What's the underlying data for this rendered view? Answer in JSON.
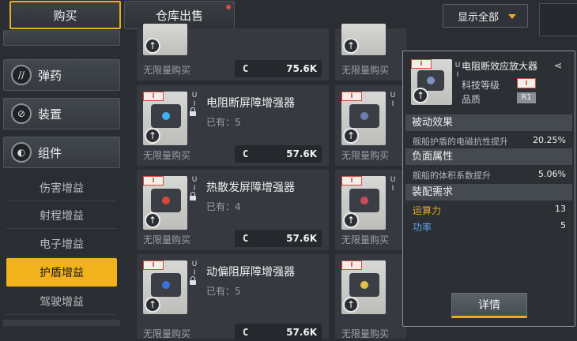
{
  "tabs": {
    "buy": "购买",
    "sell": "仓库出售"
  },
  "filter": {
    "label": "显示全部"
  },
  "sidebar": {
    "categories": [
      {
        "label": "弹药",
        "icon": "ammo-icon"
      },
      {
        "label": "装置",
        "icon": "device-icon"
      },
      {
        "label": "组件",
        "icon": "component-icon"
      }
    ],
    "subcategories": [
      "伤害增益",
      "射程增益",
      "电子增益",
      "护盾增益",
      "驾驶增益"
    ],
    "active_sub": "护盾增益"
  },
  "items": [
    {
      "name": "",
      "owned": "",
      "unlimited": "无限量购买",
      "currency": "C",
      "price": "75.6K"
    },
    {
      "name": "电阻断屏障增强器",
      "owned": "已有：5",
      "unlimited": "无限量购买",
      "currency": "C",
      "price": "57.6K"
    },
    {
      "name": "热散发屏障增强器",
      "owned": "已有：4",
      "unlimited": "无限量购买",
      "currency": "C",
      "price": "57.6K"
    },
    {
      "name": "动偏阻屏障增强器",
      "owned": "已有：5",
      "unlimited": "无限量购买",
      "currency": "C",
      "price": "57.6K"
    }
  ],
  "right_items": [
    {
      "unlimited": "无限量购买"
    },
    {
      "unlimited": "无限量购买"
    },
    {
      "unlimited": "无限量购买"
    },
    {
      "unlimited": "无限量购买"
    }
  ],
  "side_labels": {
    "u": "U",
    "i": "I",
    "tier": "I"
  },
  "detail": {
    "title": "电阻断效应放大器",
    "tech_label": "科技等级",
    "tech_value": "I",
    "quality_label": "品质",
    "quality_value": "R1",
    "passive": {
      "header": "被动效果",
      "label": "舰船护盾的电磁抗性提升",
      "value": "20.25%"
    },
    "negative": {
      "header": "负面属性",
      "label": "舰船的体积系数提升",
      "value": "5.06%"
    },
    "requirements": {
      "header": "装配需求",
      "rows": [
        {
          "label": "运算力",
          "value": "13"
        },
        {
          "label": "功率",
          "value": "5"
        }
      ]
    },
    "button": "详情"
  },
  "colors": {
    "accent": "#e8ad1c",
    "panel": "#363a40",
    "bg": "#2a2d31",
    "power": "#5aa0e6"
  }
}
